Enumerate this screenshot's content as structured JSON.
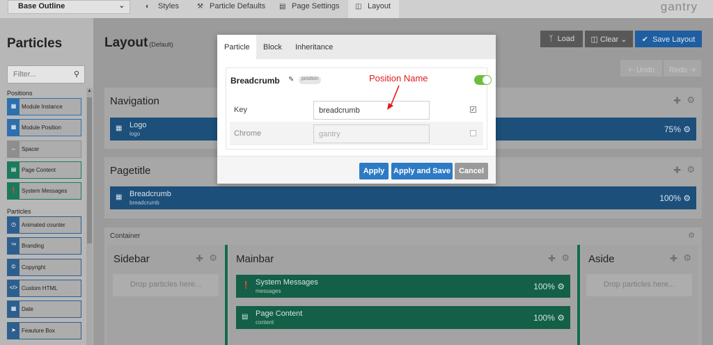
{
  "topbar": {
    "outline_select": "Base Outline",
    "tabs": [
      {
        "label": "Styles"
      },
      {
        "label": "Particle Defaults"
      },
      {
        "label": "Page Settings"
      },
      {
        "label": "Layout"
      }
    ],
    "logo": "gantry"
  },
  "sidebar": {
    "title": "Particles",
    "filter_placeholder": "Filter...",
    "positions_label": "Positions",
    "particles_label": "Particles",
    "positions": [
      "Module Instance",
      "Module Position",
      "Spacer",
      "Page Content",
      "System Messages"
    ],
    "particles": [
      "Animated counter",
      "Branding",
      "Copyright",
      "Custom HTML",
      "Date",
      "Feauture Box"
    ]
  },
  "main": {
    "title": "Layout",
    "subtitle": "(Default)",
    "buttons": {
      "load": "Load",
      "clear": "Clear",
      "save": "Save Layout",
      "undo": "Undo",
      "redo": "Redo"
    },
    "navigation": {
      "title": "Navigation",
      "block": {
        "name": "Logo",
        "id": "logo",
        "percent": "75%"
      }
    },
    "pagetitle": {
      "title": "Pagetitle",
      "block": {
        "name": "Breadcrumb",
        "id": "breadcrumb",
        "percent": "100%"
      }
    },
    "container_label": "Container",
    "sidebar_col": {
      "title": "Sidebar",
      "drop": "Drop particles here..."
    },
    "mainbar_col": {
      "title": "Mainbar",
      "blocks": [
        {
          "name": "System Messages",
          "id": "messages",
          "percent": "100%"
        },
        {
          "name": "Page Content",
          "id": "content",
          "percent": "100%"
        }
      ]
    },
    "aside_col": {
      "title": "Aside",
      "drop": "Drop particles here..."
    }
  },
  "modal": {
    "tabs": [
      "Particle",
      "Block",
      "Inheritance"
    ],
    "heading": "Breadcrumb",
    "badge": "position",
    "enabled": true,
    "fields": [
      {
        "label": "Key",
        "value": "breadcrumb",
        "checked": true
      },
      {
        "label": "Chrome",
        "value": "gantry",
        "checked": false
      }
    ],
    "buttons": {
      "apply": "Apply",
      "apply_save": "Apply and Save",
      "cancel": "Cancel"
    }
  },
  "annotation": "Position Name",
  "colors": {
    "accent": "#2d7bc4",
    "green": "#1c7a5c",
    "annotation": "#e21b1b",
    "toggle": "#6bbf3f"
  }
}
